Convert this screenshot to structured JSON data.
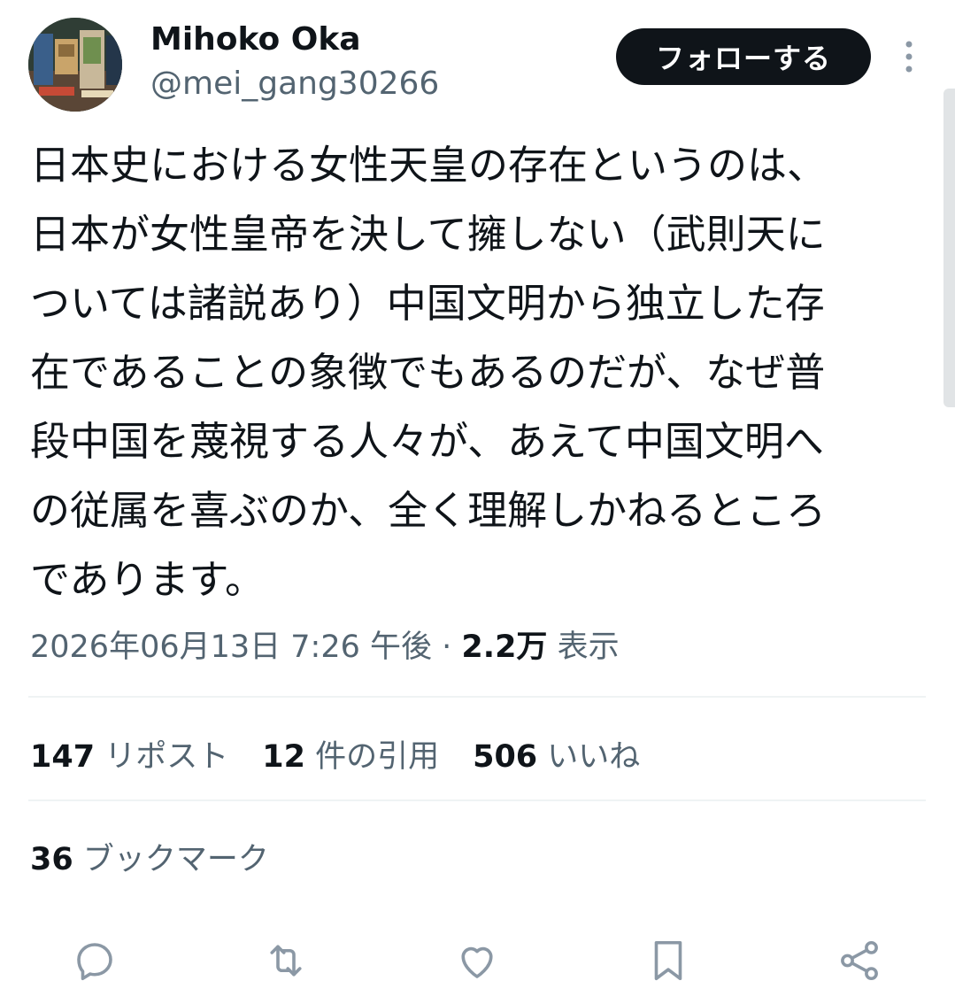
{
  "author": {
    "display_name": "Mihoko Oka",
    "handle": "@mei_gang30266",
    "follow_label": "フォローする"
  },
  "tweet": {
    "lines": [
      "日本史における女性天皇の存在というのは、",
      "日本が女性皇帝を決して擁しない（武則天に",
      "ついては諸説あり）中国文明から独立した存",
      "在であることの象徴でもあるのだが、なぜ普",
      "段中国を蔑視する人々が、あえて中国文明へ",
      "の従属を喜ぶのか、全く理解しかねるところ",
      "であります。"
    ]
  },
  "meta": {
    "timestamp": "2026年06月13日 7:26 午後",
    "separator": "·",
    "views_count": "2.2万",
    "views_label": "表示"
  },
  "stats": {
    "reposts_count": "147",
    "reposts_label": "リポスト",
    "quotes_count": "12",
    "quotes_label": "件の引用",
    "likes_count": "506",
    "likes_label": "いいね",
    "bookmarks_count": "36",
    "bookmarks_label": "ブックマーク"
  },
  "icons": {
    "more": "more-vertical-icon",
    "reply": "reply-icon",
    "repost": "repost-icon",
    "like": "heart-icon",
    "bookmark": "bookmark-icon",
    "share": "share-icon"
  },
  "colors": {
    "text_primary": "#0f1419",
    "text_secondary": "#536471",
    "follow_bg": "#0f1419",
    "icon_gray": "#8b98a5",
    "divider": "#eff3f4"
  }
}
